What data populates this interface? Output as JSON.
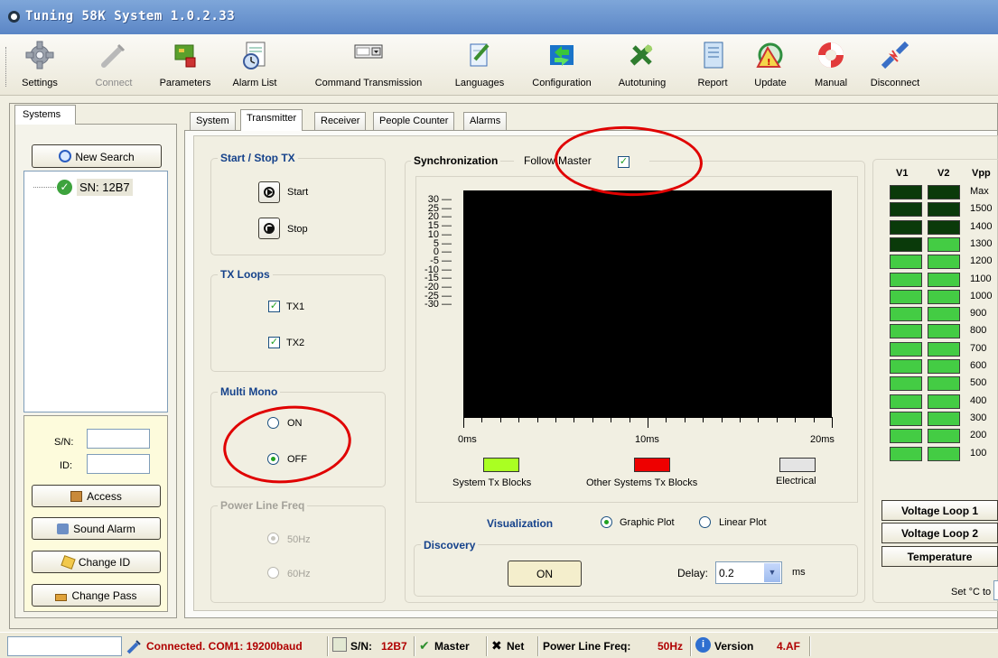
{
  "window": {
    "title": "Tuning 58K System 1.0.2.33"
  },
  "toolbar": [
    {
      "label": "Settings",
      "icon": "gear-icon",
      "enabled": true
    },
    {
      "label": "Connect",
      "icon": "plug-icon",
      "enabled": false
    },
    {
      "label": "Parameters",
      "icon": "parameters-icon",
      "enabled": true
    },
    {
      "label": "Alarm List",
      "icon": "alarm-list-icon",
      "enabled": true
    },
    {
      "label": "Command Transmission",
      "icon": "command-transmission-icon",
      "enabled": true
    },
    {
      "label": "Languages",
      "icon": "languages-icon",
      "enabled": true
    },
    {
      "label": "Configuration",
      "icon": "configuration-icon",
      "enabled": true
    },
    {
      "label": "Autotuning",
      "icon": "autotuning-icon",
      "enabled": true
    },
    {
      "label": "Report",
      "icon": "report-icon",
      "enabled": true
    },
    {
      "label": "Update",
      "icon": "update-icon",
      "enabled": true
    },
    {
      "label": "Manual",
      "icon": "lifebuoy-icon",
      "enabled": true
    },
    {
      "label": "Disconnect",
      "icon": "disconnect-icon",
      "enabled": true
    }
  ],
  "left": {
    "tab": "Systems",
    "new_search": "New Search",
    "tree_item": "SN: 12B7",
    "sn_label": "S/N:",
    "id_label": "ID:",
    "sn_value": "",
    "id_value": "",
    "buttons": [
      "Access",
      "Sound Alarm",
      "Change ID",
      "Change Pass"
    ]
  },
  "tabs": [
    "System",
    "Transmitter",
    "Receiver",
    "People Counter",
    "Alarms"
  ],
  "active_tab": "Transmitter",
  "start_stop": {
    "title": "Start / Stop TX",
    "start": "Start",
    "stop": "Stop"
  },
  "tx_loops": {
    "title": "TX Loops",
    "items": [
      {
        "label": "TX1",
        "checked": true
      },
      {
        "label": "TX2",
        "checked": true
      }
    ]
  },
  "multi_mono": {
    "title": "Multi Mono",
    "on": "ON",
    "off": "OFF",
    "selected": "OFF"
  },
  "power_line": {
    "title": "Power Line Freq",
    "opt1": "50Hz",
    "opt2": "60Hz",
    "selected": "50Hz",
    "enabled": false
  },
  "sync": {
    "title": "Synchronization",
    "follow_master": "Follow Master",
    "follow_master_checked": true,
    "y_ticks": [
      "30",
      "25",
      "20",
      "15",
      "10",
      "5",
      "0",
      "-5",
      "-10",
      "-15",
      "-20",
      "-25",
      "-30"
    ],
    "x_ticks": [
      "0ms",
      "10ms",
      "20ms"
    ],
    "legend": [
      {
        "label": "System Tx Blocks",
        "color": "#aaff22"
      },
      {
        "label": "Other Systems Tx Blocks",
        "color": "#ee0000"
      },
      {
        "label": "Electrical",
        "color": "#e4e4e4"
      }
    ],
    "visualization_label": "Visualization",
    "graphic_plot": "Graphic Plot",
    "linear_plot": "Linear Plot",
    "visualization_selected": "Graphic Plot"
  },
  "discovery": {
    "title": "Discovery",
    "button": "ON",
    "delay_label": "Delay:",
    "delay_value": "0.2",
    "unit": "ms"
  },
  "vpp": {
    "headers": [
      "V1",
      "V2",
      "Vpp"
    ],
    "levels": [
      "Max",
      "1500",
      "1400",
      "1300",
      "1200",
      "1100",
      "1000",
      "900",
      "800",
      "700",
      "600",
      "500",
      "400",
      "300",
      "200",
      "100"
    ],
    "v1_lit_from": "1200",
    "v2_lit_from": "1300",
    "lit_color": "#44cc44",
    "unlit_color": "#0a3a0a",
    "buttons": [
      "Voltage Loop 1",
      "Voltage Loop 2",
      "Temperature"
    ],
    "set_label": "Set °C to"
  },
  "statusbar": {
    "connected": "Connected. COM1: 19200baud",
    "sn_label": "S/N:",
    "sn_value": "12B7",
    "master": "Master",
    "net": "Net",
    "power_label": "Power Line Freq:",
    "power_value": "50Hz",
    "version_label": "Version",
    "version_value": "4.AF"
  }
}
